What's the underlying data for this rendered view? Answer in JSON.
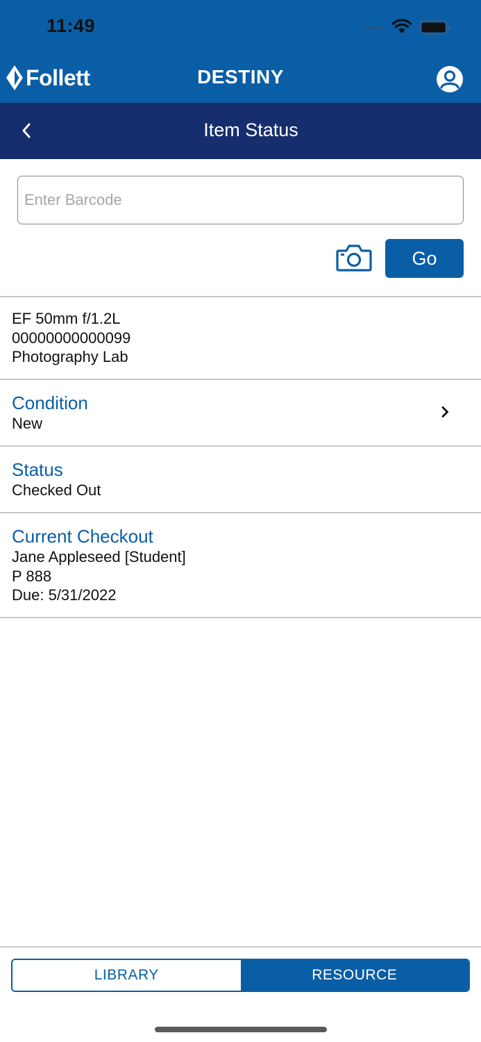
{
  "status_bar": {
    "time": "11:49"
  },
  "header": {
    "brand": "Follett",
    "title": "DESTINY"
  },
  "navbar": {
    "title": "Item Status"
  },
  "search": {
    "placeholder": "Enter Barcode",
    "value": "",
    "go_label": "Go"
  },
  "item": {
    "name": "EF 50mm f/1.2L",
    "barcode": "00000000000099",
    "location": "Photography Lab"
  },
  "condition": {
    "label": "Condition",
    "value": "New"
  },
  "status": {
    "label": "Status",
    "value": "Checked Out"
  },
  "checkout": {
    "label": "Current Checkout",
    "patron": "Jane Appleseed [Student]",
    "id": "P 888",
    "due": "Due: 5/31/2022"
  },
  "tabs": {
    "library": "LIBRARY",
    "resource": "RESOURCE",
    "selected": "RESOURCE"
  },
  "colors": {
    "brand_blue": "#0a5ea6",
    "nav_navy": "#162e6e",
    "divider": "#c9c9c9"
  }
}
